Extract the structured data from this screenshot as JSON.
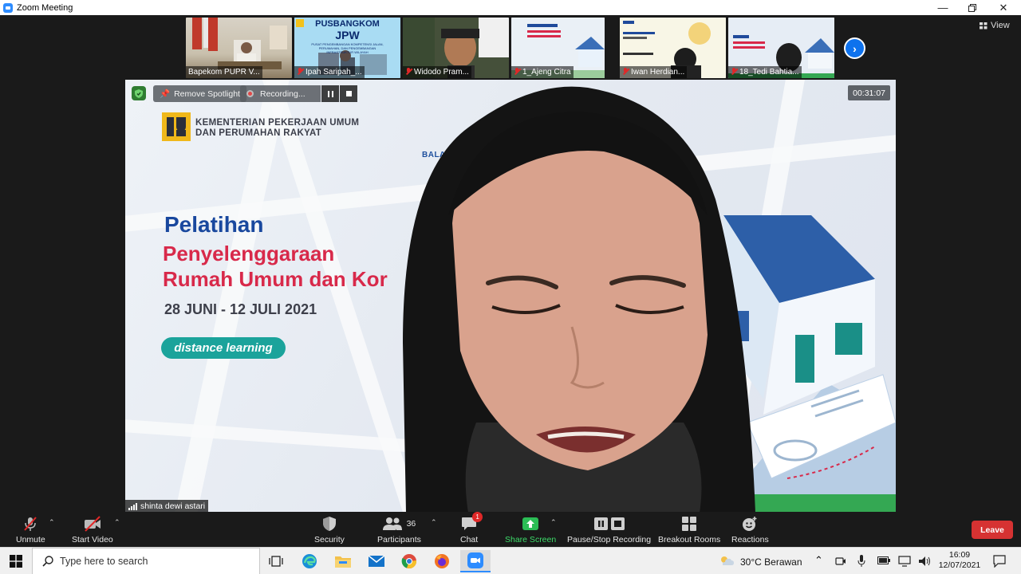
{
  "window": {
    "title": "Zoom Meeting"
  },
  "thumbnails": [
    {
      "name": "Bapekom PUPR V...",
      "muted": false
    },
    {
      "name": "Ipah Saripah_...",
      "muted": true
    },
    {
      "name": "Widodo Pram...",
      "muted": true
    },
    {
      "name": "1_Ajeng Citra",
      "muted": true
    },
    {
      "name": "Iwan Herdian...",
      "muted": true
    },
    {
      "name": "18_Tedi Bahtia...",
      "muted": true
    }
  ],
  "thumbnail_texts": {
    "jpw_title_1": "PUSBANGKOM",
    "jpw_title_2": "JPW",
    "jpw_sub": "PUSAT PENGEMBANGAN KOMPETENSI JALAN, PERUMAHAN, DAN PENGEMBANGAN INFRASTRUKTUR WILAYAH"
  },
  "view_label": "View",
  "main_video": {
    "remove_spotlight": "Remove Spotlight",
    "recording_label": "Recording...",
    "timer": "00:31:07",
    "speaker_name": "shinta dewi astari"
  },
  "slide": {
    "org_line1": "KEMENTERIAN PEKERJAAN UMUM",
    "org_line2": "DAN PERUMAHAN RAKYAT",
    "balai": "BALAI PE",
    "title_1": "Pelatihan",
    "title_2": "Penyelenggaraan",
    "title_3": "Rumah Umum dan Kor",
    "dates": "28 JUNI - 12 JULI 2021",
    "pill": "distance learning"
  },
  "toolbar": {
    "unmute": "Unmute",
    "start_video": "Start Video",
    "security": "Security",
    "participants": "Participants",
    "participants_count": "36",
    "chat": "Chat",
    "chat_badge": "1",
    "share_screen": "Share Screen",
    "pause_stop_recording": "Pause/Stop Recording",
    "breakout_rooms": "Breakout Rooms",
    "reactions": "Reactions",
    "leave": "Leave"
  },
  "taskbar": {
    "search_placeholder": "Type here to search",
    "weather": "30°C  Berawan",
    "time": "16:09",
    "date": "12/07/2021"
  },
  "colors": {
    "zoom_blue": "#2d8cff",
    "leave_red": "#d63232",
    "share_green": "#2bbd55"
  }
}
